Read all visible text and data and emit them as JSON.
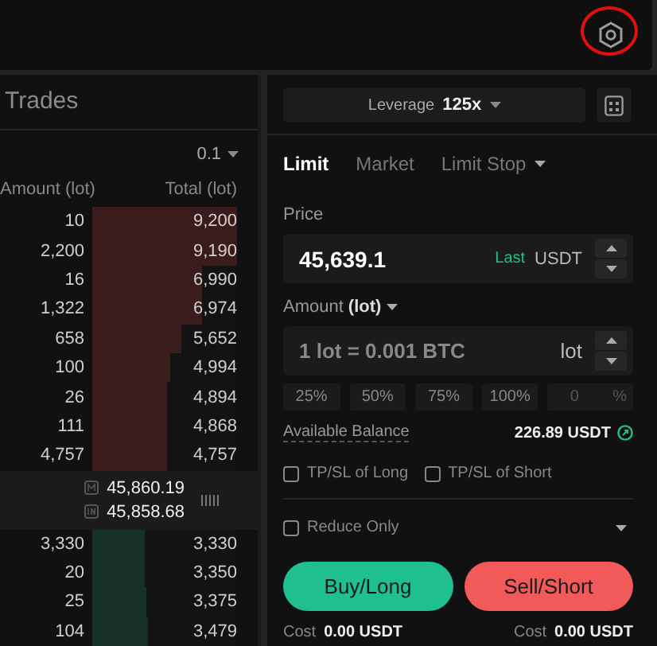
{
  "header": {
    "settings_highlighted": true
  },
  "order_book": {
    "title": "Trades",
    "precision": "0.1",
    "columns": [
      "Amount (lot)",
      "Total (lot)"
    ],
    "asks": [
      {
        "amount": "10",
        "total": "9,200",
        "level": 1
      },
      {
        "amount": "2,200",
        "total": "9,190",
        "level": 1
      },
      {
        "amount": "16",
        "total": "6,990",
        "level": 0.76
      },
      {
        "amount": "1,322",
        "total": "6,974",
        "level": 0.76
      },
      {
        "amount": "658",
        "total": "5,652",
        "level": 0.61
      },
      {
        "amount": "100",
        "total": "4,994",
        "level": 0.54
      },
      {
        "amount": "26",
        "total": "4,894",
        "level": 0.52
      },
      {
        "amount": "111",
        "total": "4,868",
        "level": 0.52
      },
      {
        "amount": "4,757",
        "total": "4,757",
        "level": 0.52
      }
    ],
    "mark_price": "45,860.19",
    "index_price": "45,858.68",
    "bids": [
      {
        "amount": "3,330",
        "total": "3,330",
        "level": 0.36
      },
      {
        "amount": "20",
        "total": "3,350",
        "level": 0.36
      },
      {
        "amount": "25",
        "total": "3,375",
        "level": 0.37
      },
      {
        "amount": "104",
        "total": "3,479",
        "level": 0.38
      }
    ]
  },
  "order_form": {
    "leverage_label": "Leverage",
    "leverage": "125x",
    "tabs": [
      {
        "label": "Limit",
        "selected": true,
        "dropdown": false
      },
      {
        "label": "Market",
        "selected": false,
        "dropdown": false
      },
      {
        "label": "Limit Stop",
        "selected": false,
        "dropdown": true
      }
    ],
    "price_label": "Price",
    "price": "45,639.1",
    "price_tag": "Last",
    "price_unit": "USDT",
    "amount_label": "Amount",
    "amount_unit_label": "(lot)",
    "amount_placeholder": "1 lot = 0.001 BTC",
    "amount_unit": "lot",
    "percent_buttons": [
      "25%",
      "50%",
      "75%",
      "100%"
    ],
    "percent_placeholder": "0",
    "percent_sign": "%",
    "balance_label": "Available Balance",
    "balance": "226.89 USDT",
    "options": [
      {
        "label": "TP/SL of Long",
        "checked": false
      },
      {
        "label": "TP/SL of Short",
        "checked": false
      }
    ],
    "reduce_only": {
      "label": "Reduce Only",
      "checked": false
    },
    "buy_label": "Buy/Long",
    "sell_label": "Sell/Short",
    "costs": [
      {
        "label": "Cost",
        "value": "0.00 USDT"
      },
      {
        "label": "Cost",
        "value": "0.00 USDT"
      }
    ]
  }
}
